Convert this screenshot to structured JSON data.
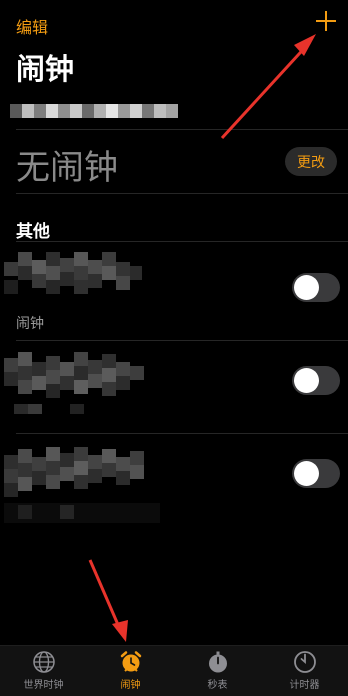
{
  "header": {
    "edit_label": "编辑",
    "title": "闹钟",
    "add_icon": "plus-icon",
    "accent_color": "#f39c12"
  },
  "sleep": {
    "no_alarm_text": "无闹钟",
    "change_label": "更改"
  },
  "other": {
    "section_title": "其他",
    "alarms": [
      {
        "label": "闹钟",
        "enabled": false
      },
      {
        "label": "",
        "enabled": false
      },
      {
        "label": "",
        "enabled": false
      }
    ]
  },
  "tabbar": {
    "tabs": [
      {
        "label": "世界时钟",
        "icon": "globe-icon",
        "active": false
      },
      {
        "label": "闹钟",
        "icon": "alarm-clock-icon",
        "active": true
      },
      {
        "label": "秒表",
        "icon": "stopwatch-icon",
        "active": false
      },
      {
        "label": "计时器",
        "icon": "timer-icon",
        "active": false
      }
    ]
  }
}
